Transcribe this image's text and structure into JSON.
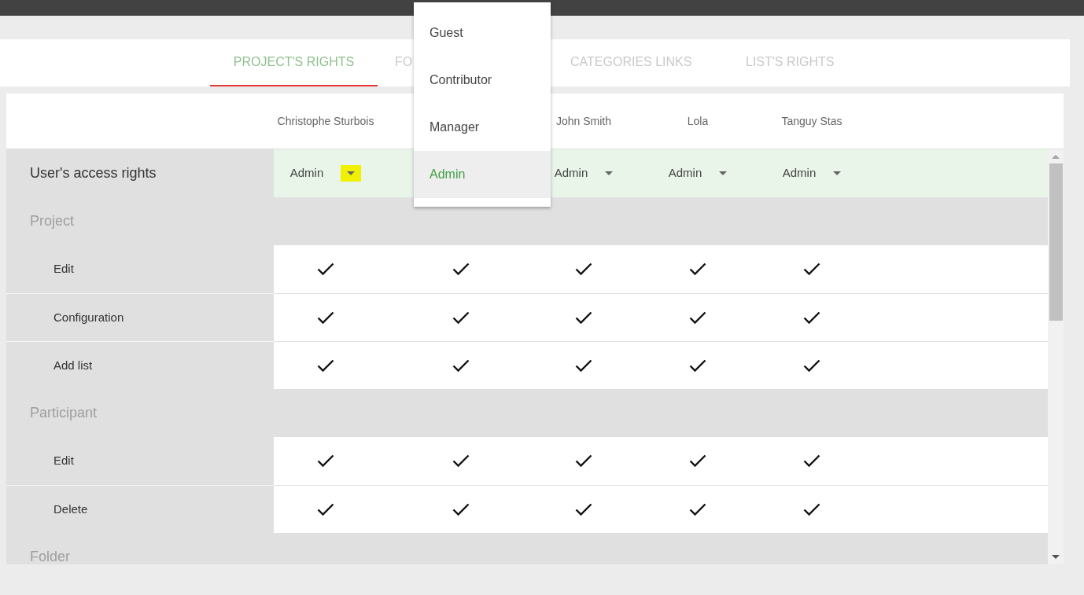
{
  "tabs": [
    {
      "label": "PROJECT'S RIGHTS",
      "selected": true
    },
    {
      "label": "FO",
      "selected": false
    },
    {
      "label": "CATEGORIES LINKS",
      "selected": false
    },
    {
      "label": "LIST'S RIGHTS",
      "selected": false
    }
  ],
  "users": [
    {
      "kind": "user",
      "name": "Christophe Sturbois",
      "role": "Admin",
      "highlighted": true
    },
    {
      "kind": "covered"
    },
    {
      "kind": "user",
      "name": "John Smith",
      "role": "Admin",
      "highlighted": false
    },
    {
      "kind": "user",
      "name": "Lola",
      "role": "Admin",
      "highlighted": false
    },
    {
      "kind": "user",
      "name": "Tanguy Stas",
      "role": "Admin",
      "highlighted": false
    }
  ],
  "access_label": "User's access rights",
  "sections": [
    {
      "title": "Project",
      "rights": [
        {
          "label": "Edit",
          "checks": [
            true,
            true,
            true,
            true,
            true
          ]
        },
        {
          "label": "Configuration",
          "checks": [
            true,
            true,
            true,
            true,
            true
          ]
        },
        {
          "label": "Add list",
          "checks": [
            true,
            true,
            true,
            true,
            true
          ]
        }
      ]
    },
    {
      "title": "Participant",
      "rights": [
        {
          "label": "Edit",
          "checks": [
            true,
            true,
            true,
            true,
            true
          ]
        },
        {
          "label": "Delete",
          "checks": [
            true,
            true,
            true,
            true,
            true
          ]
        }
      ]
    },
    {
      "title": "Folder"
    }
  ],
  "menu": {
    "items": [
      {
        "label": "Guest",
        "selected": false
      },
      {
        "label": "Contributor",
        "selected": false
      },
      {
        "label": "Manager",
        "selected": false
      },
      {
        "label": "Admin",
        "selected": true
      }
    ]
  }
}
